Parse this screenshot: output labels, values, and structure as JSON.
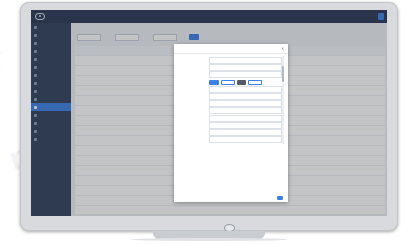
{
  "window": {
    "title": "",
    "action_label": ""
  },
  "sidebar": {
    "items": [
      {
        "label": ""
      },
      {
        "label": ""
      },
      {
        "label": ""
      },
      {
        "label": ""
      },
      {
        "label": ""
      },
      {
        "label": ""
      },
      {
        "label": ""
      },
      {
        "label": ""
      },
      {
        "label": ""
      },
      {
        "label": ""
      },
      {
        "label": ""
      },
      {
        "label": ""
      },
      {
        "label": ""
      },
      {
        "label": ""
      },
      {
        "label": ""
      }
    ],
    "active_index": 10
  },
  "modal": {
    "title": "",
    "close_glyph": "×",
    "fields": [
      {
        "label": "",
        "value": ""
      },
      {
        "label": "",
        "value": ""
      },
      {
        "label": "",
        "value": ""
      },
      {
        "label": "",
        "value": ""
      },
      {
        "label": "",
        "value": ""
      },
      {
        "label": "",
        "value": ""
      },
      {
        "label": "",
        "value": ""
      },
      {
        "label": "",
        "value": ""
      },
      {
        "label": "",
        "value": ""
      },
      {
        "label": "",
        "value": ""
      },
      {
        "label": "",
        "value": ""
      },
      {
        "label": "",
        "value": ""
      }
    ],
    "code_lines": [
      "",
      "",
      "",
      "",
      ""
    ]
  },
  "colors": {
    "topbar": "#2b3a55",
    "sidebar": "#33425e",
    "accent": "#3d82e4",
    "page_background": "#eef1f5"
  },
  "icons": [
    "app-logo-icon",
    "close-icon"
  ]
}
